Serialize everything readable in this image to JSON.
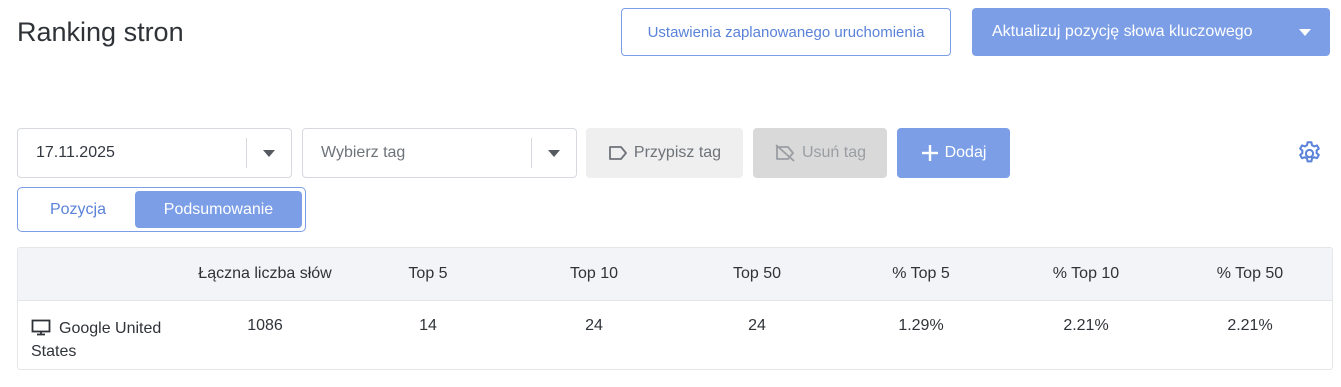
{
  "header": {
    "title": "Ranking stron",
    "schedule_button": "Ustawienia zaplanowanego uruchomienia",
    "update_button": "Aktualizuj pozycję słowa kluczowego"
  },
  "toolbar": {
    "date_value": "17.11.2025",
    "tag_placeholder": "Wybierz tag",
    "assign_tag": "Przypisz tag",
    "remove_tag": "Usuń tag",
    "add": "Dodaj"
  },
  "view_toggle": {
    "options": [
      "Pozycja",
      "Podsumowanie"
    ],
    "selected": "Podsumowanie"
  },
  "table": {
    "columns": [
      "",
      "Łączna liczba słów",
      "Top 5",
      "Top 10",
      "Top 50",
      "% Top 5",
      "% Top 10",
      "% Top 50"
    ],
    "rows": [
      {
        "engine": "Google United States",
        "device_icon": "desktop-icon",
        "total_words": "1086",
        "top5": "14",
        "top10": "24",
        "top50": "24",
        "pct_top5": "1.29%",
        "pct_top10": "2.21%",
        "pct_top50": "2.21%"
      }
    ]
  },
  "colors": {
    "accent": "#7b9ee6",
    "accent_text": "#5a82d8",
    "header_bg": "#f3f4f7"
  }
}
